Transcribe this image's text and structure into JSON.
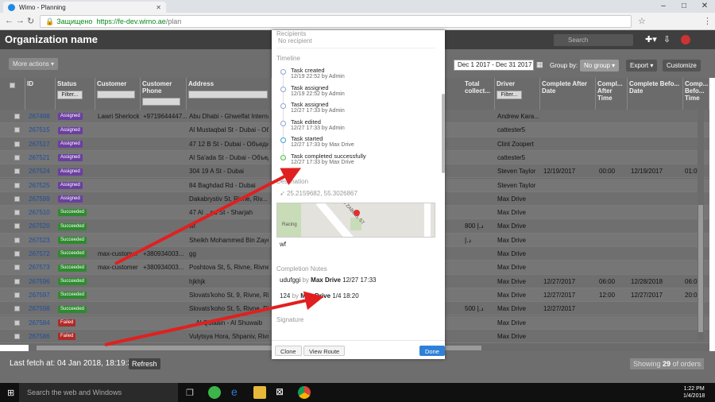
{
  "browser": {
    "tab_title": "Wimo - Planning",
    "security_label": "Защищено",
    "url_host": "https://fe-dev.wimo.ae",
    "url_path": "/plan"
  },
  "app": {
    "org_name": "Organization name",
    "search_placeholder": "Search",
    "more_actions": "More actions",
    "date_range": "Dec 1 2017 - Dec 31 2017",
    "group_by_label": "Group by:",
    "group_by_value": "No group",
    "export_label": "Export",
    "customize_label": "Customize"
  },
  "table": {
    "filter_label": "Filter...",
    "columns": {
      "id": "ID",
      "status": "Status",
      "customer": "Customer",
      "customer_phone": "Customer Phone",
      "address": "Address",
      "total_collect": "Total collect...",
      "driver": "Driver",
      "complete_after_date": "Complete After Date",
      "complete_after_time": "Compl... After Time",
      "complete_before_date": "Complete Befo... Date",
      "complete_before_time": "Comp... Befo... Time"
    },
    "rows": [
      {
        "id": "267498",
        "status": "Assigned",
        "customer": "Lawri Sherlock",
        "phone": "+9719644447...",
        "address": "Abu Dhabi - Ghwelfat Internati...",
        "total": "",
        "driver": "Andrew Kara...",
        "cad": "",
        "cat": "",
        "cbd": "",
        "cbt": ""
      },
      {
        "id": "267515",
        "status": "Assigned",
        "customer": "",
        "phone": "",
        "address": "Al Mustaqbal St - Dubai - Объ...",
        "total": "",
        "driver": "cattester5",
        "cad": "",
        "cat": "",
        "cbd": "",
        "cbt": ""
      },
      {
        "id": "267517",
        "status": "Assigned",
        "customer": "",
        "phone": "",
        "address": "47 12 B St - Dubai - Объедин...",
        "total": "",
        "driver": "Clint Zoopert",
        "cad": "",
        "cat": "",
        "cbd": "",
        "cbt": ""
      },
      {
        "id": "267521",
        "status": "Assigned",
        "customer": "",
        "phone": "",
        "address": "Al Sa'ada St - Dubai - Объеди...",
        "total": "",
        "driver": "cattester5",
        "cad": "",
        "cat": "",
        "cbd": "",
        "cbt": ""
      },
      {
        "id": "267524",
        "status": "Assigned",
        "customer": "",
        "phone": "",
        "address": "304 19 A St - Dubai",
        "total": "",
        "driver": "Steven Taylor",
        "cad": "12/19/2017",
        "cat": "00:00",
        "cbd": "12/19/2017",
        "cbt": "01:00"
      },
      {
        "id": "267525",
        "status": "Assigned",
        "customer": "",
        "phone": "",
        "address": "84 Baghdad Rd - Dubai",
        "total": "",
        "driver": "Steven Taylor",
        "cad": "",
        "cat": "",
        "cbd": "",
        "cbt": ""
      },
      {
        "id": "267599",
        "status": "Assigned",
        "customer": "",
        "phone": "",
        "address": "Dakabrystiv St, Rivne, Riv...",
        "total": "",
        "driver": "Max Drive",
        "cad": "",
        "cat": "",
        "cbd": "",
        "cbt": ""
      },
      {
        "id": "267510",
        "status": "Succeeded",
        "customer": "",
        "phone": "",
        "address": "47 Al ...na St - Sharjah",
        "total": "",
        "driver": "Max Drive",
        "cad": "",
        "cat": "",
        "cbd": "",
        "cbt": ""
      },
      {
        "id": "267520",
        "status": "Succeeded",
        "customer": "",
        "phone": "",
        "address": "wf",
        "total": "800 د.إ",
        "driver": "Max Drive",
        "cad": "",
        "cat": "",
        "cbd": "",
        "cbt": ""
      },
      {
        "id": "267523",
        "status": "Succeeded",
        "customer": "",
        "phone": "",
        "address": "Sheikh Mohammed Bin Zayed ...",
        "total": "د.إ",
        "driver": "Max Drive",
        "cad": "",
        "cat": "",
        "cbd": "",
        "cbt": ""
      },
      {
        "id": "267572",
        "status": "Succeeded",
        "customer": "max-customer",
        "phone": "+380934003...",
        "address": "gg",
        "total": "",
        "driver": "Max Drive",
        "cad": "",
        "cat": "",
        "cbd": "",
        "cbt": ""
      },
      {
        "id": "267573",
        "status": "Succeeded",
        "customer": "max-customer",
        "phone": "+380934003...",
        "address": "Poshtova St, 5, Rivne, Rivne...",
        "total": "",
        "driver": "Max Drive",
        "cad": "",
        "cat": "",
        "cbd": "",
        "cbt": ""
      },
      {
        "id": "267596",
        "status": "Succeeded",
        "customer": "",
        "phone": "",
        "address": "hjkhjk",
        "total": "",
        "driver": "Max Drive",
        "cad": "12/27/2017",
        "cat": "06:00",
        "cbd": "12/28/2018",
        "cbt": "06:00"
      },
      {
        "id": "267597",
        "status": "Succeeded",
        "customer": "",
        "phone": "",
        "address": "Slovats'koho St, 9, Rivne, Riv...",
        "total": "",
        "driver": "Max Drive",
        "cad": "12/27/2017",
        "cat": "12:00",
        "cbd": "12/27/2017",
        "cbt": "20:00"
      },
      {
        "id": "267598",
        "status": "Succeeded",
        "customer": "",
        "phone": "",
        "address": "Slovats'koho St, 5, Rivne, Riv...",
        "total": "500 د.إ",
        "driver": "Max Drive",
        "cad": "12/27/2017",
        "cat": "",
        "cbd": "",
        "cbt": ""
      },
      {
        "id": "267584",
        "status": "Failed",
        "customer": "",
        "phone": "",
        "address": "... Al Qulaain - Al Shuwaib",
        "total": "",
        "driver": "Max Drive",
        "cad": "",
        "cat": "",
        "cbd": "",
        "cbt": ""
      },
      {
        "id": "267586",
        "status": "Failed",
        "customer": "",
        "phone": "",
        "address": "Vulytsya Hora, Shpaniv, Rivn...",
        "total": "",
        "driver": "Max Drive",
        "cad": "",
        "cat": "",
        "cbd": "",
        "cbt": ""
      }
    ]
  },
  "footer": {
    "last_fetch": "Last fetch at: 04 Jan 2018, 18:19:35",
    "refresh": "Refresh",
    "showing_prefix": "Showing",
    "showing_count": "29",
    "showing_suffix": "of orders"
  },
  "panel": {
    "recipients_header": "Recipients",
    "no_recipient": "No recipient",
    "timeline_header": "Timeline",
    "timeline": [
      {
        "title": "Task created",
        "meta": "12/19 22:52 by Admin"
      },
      {
        "title": "Task assigned",
        "meta": "12/19 22:52 by Admin"
      },
      {
        "title": "Task assigned",
        "meta": "12/27 17:33 by Admin"
      },
      {
        "title": "Task edited",
        "meta": "12/27 17:33 by Admin"
      },
      {
        "title": "Task started",
        "meta": "12/27 17:33 by Max Drive"
      },
      {
        "title": "Task completed successfully",
        "meta": "12/27 17:33 by Max Drive"
      }
    ],
    "destination_header": "Destination",
    "coords": "25.2159682, 55.3026867",
    "map_street": "2ND ZABEEL ST",
    "map_label": "Racing",
    "address": "wf",
    "completion_header": "Completion Notes",
    "note1_text": "udufggi",
    "note1_by": "by",
    "note1_author": "Max Drive",
    "note1_time": "12/27 17:33",
    "note2_text": "124",
    "note2_by": "by",
    "note2_author": "Max Drive",
    "note2_time": "1/4 18:20",
    "signature_header": "Signature",
    "clone": "Clone",
    "view_route": "View Route",
    "done": "Done"
  },
  "taskbar": {
    "search": "Search the web and Windows",
    "time": "1:22 PM",
    "date": "1/4/2018"
  },
  "colors": {
    "assigned": "#6b3fa0",
    "succeeded": "#2f8a2f",
    "failed": "#b02a2a",
    "done_button": "#2f80d8",
    "arrow": "#e02020"
  }
}
